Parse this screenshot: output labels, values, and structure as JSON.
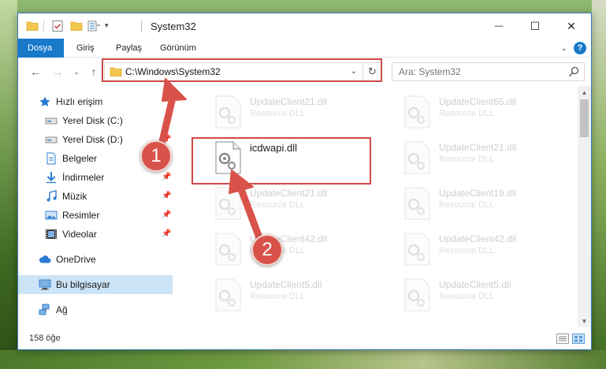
{
  "window": {
    "title": "System32",
    "controls": {
      "minimize": "—",
      "maximize": "☐",
      "close": "✕"
    }
  },
  "ribbon": {
    "tabs": [
      {
        "label": "Dosya",
        "active": true
      },
      {
        "label": "Giriş",
        "active": false
      },
      {
        "label": "Paylaş",
        "active": false
      },
      {
        "label": "Görünüm",
        "active": false
      }
    ],
    "help": "?"
  },
  "navigation": {
    "address": "C:\\Windows\\System32",
    "search_placeholder": "Ara: System32"
  },
  "sidebar": {
    "items": [
      {
        "label": "Hızlı erişim",
        "icon": "star-icon"
      },
      {
        "label": "Yerel Disk (C:)",
        "icon": "drive-icon",
        "pinned": true
      },
      {
        "label": "Yerel Disk (D:)",
        "icon": "drive-icon",
        "pinned": true
      },
      {
        "label": "Belgeler",
        "icon": "document-icon",
        "pinned": true
      },
      {
        "label": "İndirmeler",
        "icon": "download-icon",
        "pinned": true
      },
      {
        "label": "Müzik",
        "icon": "music-icon",
        "pinned": true
      },
      {
        "label": "Resimler",
        "icon": "picture-icon",
        "pinned": true
      },
      {
        "label": "Videolar",
        "icon": "video-icon",
        "pinned": true
      },
      {
        "label": "OneDrive",
        "icon": "cloud-icon"
      },
      {
        "label": "Bu bilgisayar",
        "icon": "computer-icon",
        "selected": true
      },
      {
        "label": "Ağ",
        "icon": "network-icon"
      }
    ]
  },
  "files": {
    "left": [
      {
        "name": "UpdateClient21.dll",
        "type": "Resource DLL",
        "faded": true
      },
      {
        "name": "icdwapi.dll",
        "type": "",
        "faded": false
      },
      {
        "name": "UpdateClient21.dll",
        "type": "Resource DLL",
        "faded": true
      },
      {
        "name": "UpdateClient42.dll",
        "type": "Resource DLL",
        "faded": true
      },
      {
        "name": "UpdateClient5.dll",
        "type": "Resource DLL",
        "faded": true
      }
    ],
    "right": [
      {
        "name": "UpdateClient65.dll",
        "type": "Resource DLL"
      },
      {
        "name": "UpdateClient21.dll",
        "type": "Resource DLL"
      },
      {
        "name": "UpdateClient19.dll",
        "type": "Resource DLL"
      },
      {
        "name": "UpdateClient42.dll",
        "type": "Resource DLL"
      },
      {
        "name": "UpdateClient5.dll",
        "type": "Resource DLL"
      }
    ]
  },
  "status": {
    "count": "158 öğe"
  },
  "callouts": {
    "first": "1",
    "second": "2"
  },
  "colors": {
    "accent": "#1979ca",
    "highlight": "#d04848",
    "callout": "#d9524a"
  }
}
